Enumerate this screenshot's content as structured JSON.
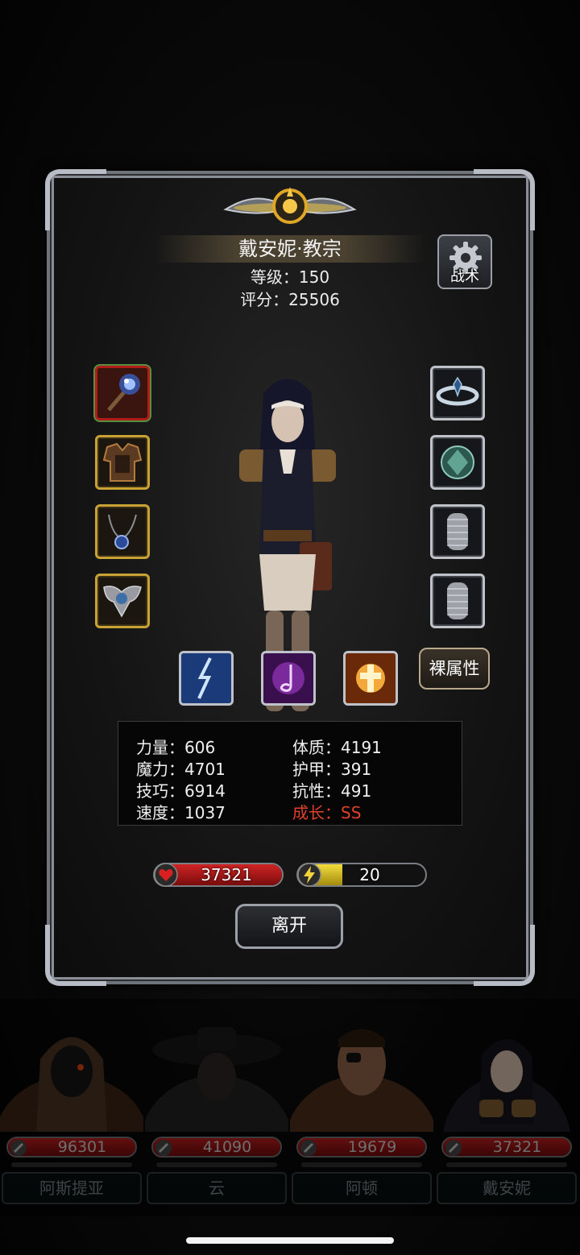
{
  "character": {
    "name": "戴安妮·教宗",
    "level_line": "等级：150",
    "score_line": "评分：25506"
  },
  "buttons": {
    "tactics": "战术",
    "bare_attributes": "裸属性",
    "leave": "离开"
  },
  "equipment_left": [
    {
      "name": "mace-icon",
      "frame": "red"
    },
    {
      "name": "armor-icon",
      "frame": "gold"
    },
    {
      "name": "amulet-icon",
      "frame": "gold"
    },
    {
      "name": "winged-emblem-icon",
      "frame": "gold"
    }
  ],
  "equipment_right": [
    {
      "name": "halo-icon",
      "frame": "silver"
    },
    {
      "name": "gem-icon",
      "frame": "silver"
    },
    {
      "name": "chain-mail-icon",
      "frame": "silver"
    },
    {
      "name": "chain-mail-icon",
      "frame": "silver"
    }
  ],
  "skills": [
    {
      "name": "lightning-skill-icon"
    },
    {
      "name": "music-note-skill-icon"
    },
    {
      "name": "holy-shield-skill-icon"
    }
  ],
  "stats": {
    "strength": "力量：606",
    "magic": "魔力：4701",
    "skill": "技巧：6914",
    "speed": "速度：1037",
    "constitution": "体质：4191",
    "armor": "护甲：391",
    "resistance": "抗性：491",
    "growth": "成长：SS"
  },
  "bars": {
    "hp_value": "37321",
    "hp_fill": 1.0,
    "energy_value": "20",
    "energy_fill": 0.35
  },
  "roster": [
    {
      "hp": "96301",
      "name": "阿斯提亚"
    },
    {
      "hp": "41090",
      "name": "云"
    },
    {
      "hp": "19679",
      "name": "阿顿"
    },
    {
      "hp": "37321",
      "name": "戴安妮"
    }
  ],
  "colors": {
    "accent_gold": "#c9a236",
    "hp_red": "#c4201c",
    "energy_yellow": "#e6cf1e",
    "growth_red": "#e0412a"
  }
}
